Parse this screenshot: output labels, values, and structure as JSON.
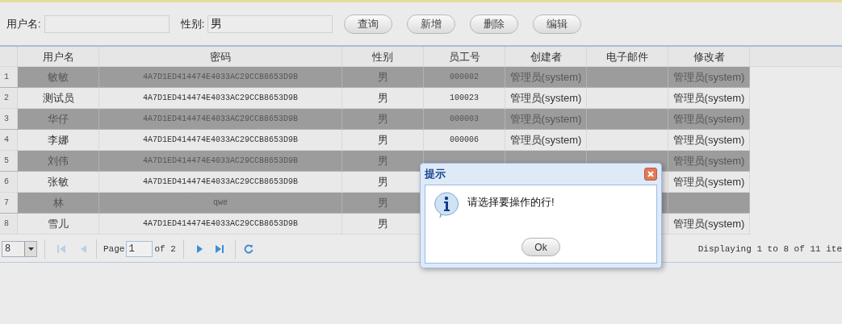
{
  "search": {
    "fields": [
      {
        "label": "用户名:"
      },
      {
        "label": "性别:",
        "value": "男"
      }
    ],
    "buttons": [
      "查询",
      "新增",
      "删除",
      "编辑"
    ]
  },
  "table": {
    "columns": [
      "用户名",
      "密码",
      "性别",
      "员工号",
      "创建者",
      "电子邮件",
      "修改者"
    ],
    "rows": [
      {
        "number": "1",
        "highlighted": true,
        "cells": [
          "敏敏",
          "4A7D1ED414474E4033AC29CCB8653D9B",
          "男",
          "000002",
          "管理员(system)",
          null,
          "管理员(system)"
        ]
      },
      {
        "number": "2",
        "highlighted": false,
        "cells": [
          "测试员",
          "4A7D1ED414474E4033AC29CCB8653D9B",
          "男",
          "100023",
          "管理员(system)",
          null,
          "管理员(system)"
        ]
      },
      {
        "number": "3",
        "highlighted": true,
        "cells": [
          "华仔",
          "4A7D1ED414474E4033AC29CCB8653D9B",
          "男",
          "000003",
          "管理员(system)",
          null,
          "管理员(system)"
        ]
      },
      {
        "number": "4",
        "highlighted": false,
        "cells": [
          "李娜",
          "4A7D1ED414474E4033AC29CCB8653D9B",
          "男",
          "000006",
          "管理员(system)",
          null,
          "管理员(system)"
        ]
      },
      {
        "number": "5",
        "highlighted": true,
        "cells": [
          "刘伟",
          "4A7D1ED414474E4033AC29CCB8653D9B",
          "男",
          null,
          null,
          null,
          "管理员(system)"
        ]
      },
      {
        "number": "6",
        "highlighted": false,
        "cells": [
          "张敏",
          "4A7D1ED414474E4033AC29CCB8653D9B",
          "男",
          null,
          null,
          null,
          "管理员(system)"
        ]
      },
      {
        "number": "7",
        "highlighted": true,
        "cells": [
          "林",
          "qwe",
          "男",
          null,
          null,
          null,
          null
        ]
      },
      {
        "number": "8",
        "highlighted": false,
        "cells": [
          "雪儿",
          "4A7D1ED414474E4033AC29CCB8653D9B",
          "男",
          null,
          null,
          null,
          "管理员(system)"
        ]
      }
    ]
  },
  "pager": {
    "page_size": "8",
    "page_label": "Page",
    "page": "1",
    "of_label": "of 2",
    "summary": "Displaying 1 to 8 of 11 ite"
  },
  "dialog": {
    "title": "提示",
    "message": "请选择要操作的行!",
    "button": "Ok"
  }
}
